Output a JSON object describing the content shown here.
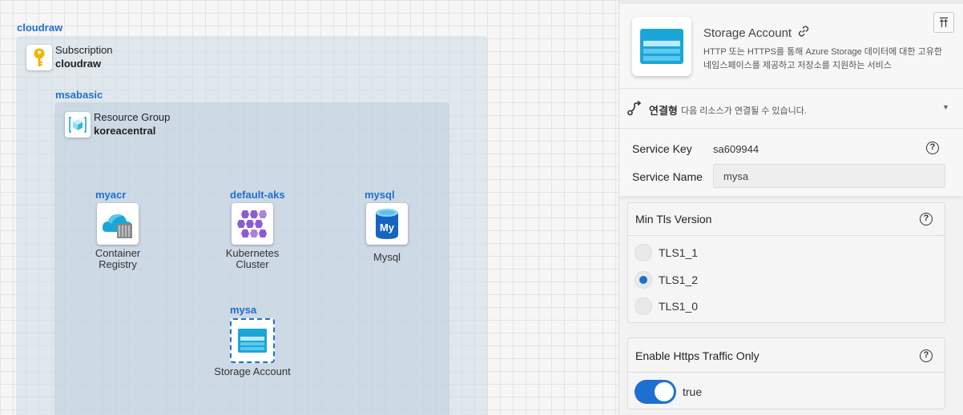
{
  "canvas": {
    "root_group": "cloudraw",
    "subscription": {
      "type_label": "Subscription",
      "name": "cloudraw"
    },
    "subscription_group": "msabasic",
    "resource_group": {
      "type_label": "Resource Group",
      "name": "koreacentral"
    },
    "nodes": [
      {
        "name": "myacr",
        "label": "Container Registry"
      },
      {
        "name": "default-aks",
        "label": "Kubernetes Cluster"
      },
      {
        "name": "mysql",
        "label": "Mysql"
      },
      {
        "name": "mysa",
        "label": "Storage Account"
      }
    ]
  },
  "panel": {
    "title": "Storage Account",
    "description": "HTTP 또는 HTTPS를 통해 Azure Storage 데이터에 대한 고유한 네임스페이스를 제공하고 저장소를 지원하는 서비스",
    "connection": {
      "title": "연결형",
      "description": "다음 리소스가 연결될 수 있습니다."
    },
    "service_key_label": "Service Key",
    "service_key_value": "sa609944",
    "service_name_label": "Service Name",
    "service_name_value": "mysa",
    "min_tls": {
      "label": "Min Tls Version",
      "options": [
        "TLS1_1",
        "TLS1_2",
        "TLS1_0"
      ],
      "selected": "TLS1_2"
    },
    "https_only": {
      "label": "Enable Https Traffic Only",
      "value": "true"
    }
  },
  "colors": {
    "accent": "#1e6fd0",
    "azure_blue": "#1aa7d8",
    "aks_purple": "#8b5cd6"
  }
}
